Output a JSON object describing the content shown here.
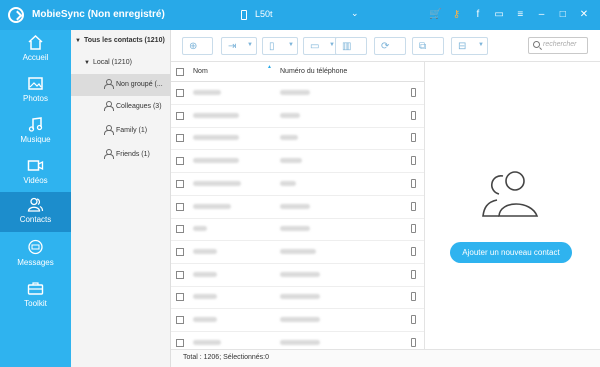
{
  "app": {
    "title": "MobieSync (Non enregistré)",
    "device_name": "L50t",
    "accent_color": "#28a9e8",
    "sidebar_color": "#2fb3ef",
    "title_icons": [
      "cart-icon",
      "key-icon",
      "facebook-icon",
      "chat-icon",
      "menu-icon",
      "minimize-icon",
      "maximize-icon",
      "close-icon"
    ]
  },
  "sidebar": {
    "items": [
      {
        "label": "Accueil",
        "icon": "home-icon"
      },
      {
        "label": "Photos",
        "icon": "photo-icon"
      },
      {
        "label": "Musique",
        "icon": "music-icon"
      },
      {
        "label": "Vidéos",
        "icon": "video-icon"
      },
      {
        "label": "Contacts",
        "icon": "contacts-icon",
        "active": true
      },
      {
        "label": "Messages",
        "icon": "messages-icon"
      },
      {
        "label": "Toolkit",
        "icon": "toolkit-icon"
      }
    ]
  },
  "tree": {
    "all": "Tous les contacts  (1210)",
    "local": "Local  (1210)",
    "groups": [
      {
        "label": "Non groupé  (...",
        "selected": true
      },
      {
        "label": "Colleagues  (3)"
      },
      {
        "label": "Family  (1)"
      },
      {
        "label": "Friends  (1)"
      }
    ]
  },
  "toolbar": {
    "buttons": [
      "add-icon",
      "import-icon",
      "export-icon",
      "screen-icon",
      "delete-icon",
      "refresh-icon",
      "copy-icon",
      "toolbox-icon"
    ],
    "search_placeholder": "rechercher"
  },
  "table": {
    "col_name": "Nom",
    "col_phone": "Numéro du téléphone",
    "row_count_visible": 13
  },
  "footer": {
    "status": "Total : 1206; Sélectionnés:0"
  },
  "panel": {
    "add_contact": "Ajouter un nouveau contact"
  }
}
